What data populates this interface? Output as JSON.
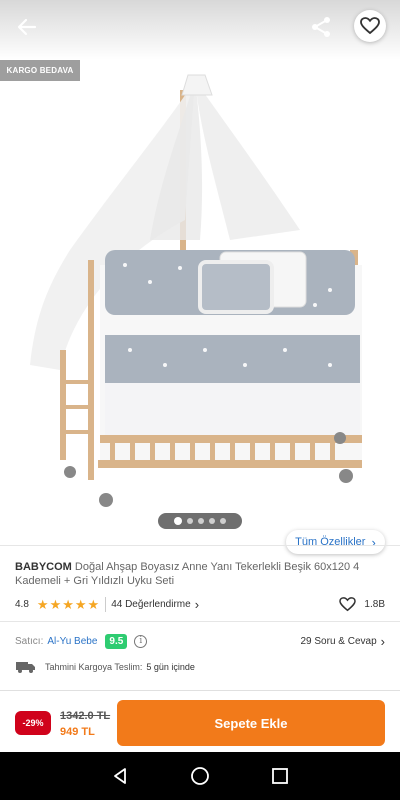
{
  "product_image": {
    "badge": "KARGO BEDAVA",
    "features_label": "Tüm Özellikler",
    "page_dots": 5,
    "active_dot": 1
  },
  "product": {
    "brand": "BABYCOM",
    "name": "Doğal Ahşap Boyasız Anne Yanı Tekerlekli Beşik 60x120 4 Kademeli + Gri Yıldızlı Uyku Seti",
    "rating": "4.8",
    "stars": 5,
    "reviews": "44 Değerlendirme",
    "likes": "1.8B"
  },
  "seller": {
    "label": "Satıcı:",
    "name": "Al-Yu Bebe",
    "score": "9.5",
    "qa": "29 Soru & Cevap"
  },
  "shipping": {
    "label": "Tahmini Kargoya Teslim:",
    "value": "5 gün içinde"
  },
  "purchase": {
    "discount": "-29%",
    "old_price": "1342.0 TL",
    "new_price": "949 TL",
    "button": "Sepete Ekle"
  },
  "colors": {
    "accent": "#f27a1a",
    "discount": "#d0021b",
    "link": "#2a73c7",
    "score": "#2ecc71",
    "star": "#f5a623"
  }
}
